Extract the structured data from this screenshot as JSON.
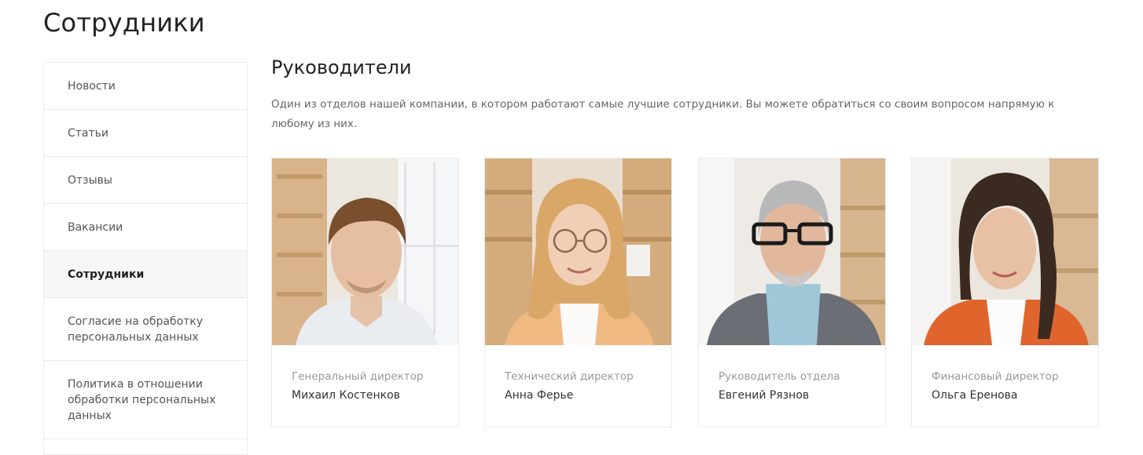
{
  "page": {
    "title": "Сотрудники"
  },
  "sidebar": {
    "items": [
      {
        "label": "Новости"
      },
      {
        "label": "Статьи"
      },
      {
        "label": "Отзывы"
      },
      {
        "label": "Вакансии"
      },
      {
        "label": "Сотрудники",
        "active": true
      },
      {
        "label": "Согласие на обработку персональных данных"
      },
      {
        "label": "Политика в отношении обработки персональных данных"
      }
    ]
  },
  "section": {
    "title": "Руководители",
    "description": "Один из отделов нашей компании, в котором работают самые лучшие сотрудники. Вы можете обратиться со своим вопросом напрямую к любому из них."
  },
  "employees": [
    {
      "role": "Генеральный директор",
      "name": "Михаил Костенков",
      "photo": "portrait-man-young"
    },
    {
      "role": "Технический директор",
      "name": "Анна Ферье",
      "photo": "portrait-woman-glasses"
    },
    {
      "role": "Руководитель отдела",
      "name": "Евгений Рязнов",
      "photo": "portrait-man-senior-glasses"
    },
    {
      "role": "Финансовый директор",
      "name": "Ольга Еренова",
      "photo": "portrait-woman-braid"
    }
  ],
  "colors": {
    "border": "#ececec",
    "active_bg": "#f7f7f8",
    "text_dark": "#222222",
    "text_muted": "#999999",
    "shelf_wood": "#d9b48a"
  }
}
